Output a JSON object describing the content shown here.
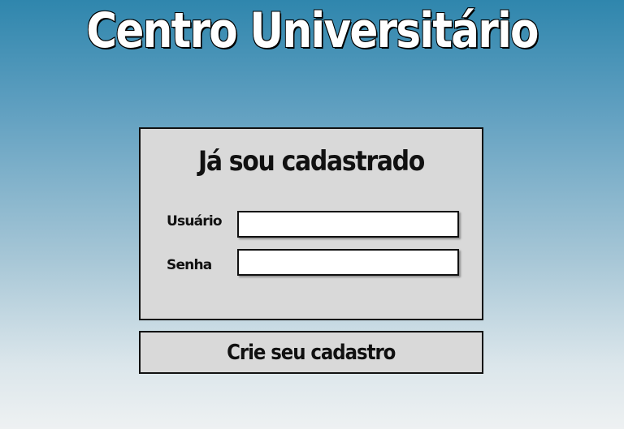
{
  "header": {
    "title": "Centro Universitário"
  },
  "login": {
    "title": "Já sou cadastrado",
    "username_label": "Usuário",
    "username_value": "",
    "password_label": "Senha",
    "password_value": ""
  },
  "register": {
    "label": "Crie seu cadastro"
  }
}
